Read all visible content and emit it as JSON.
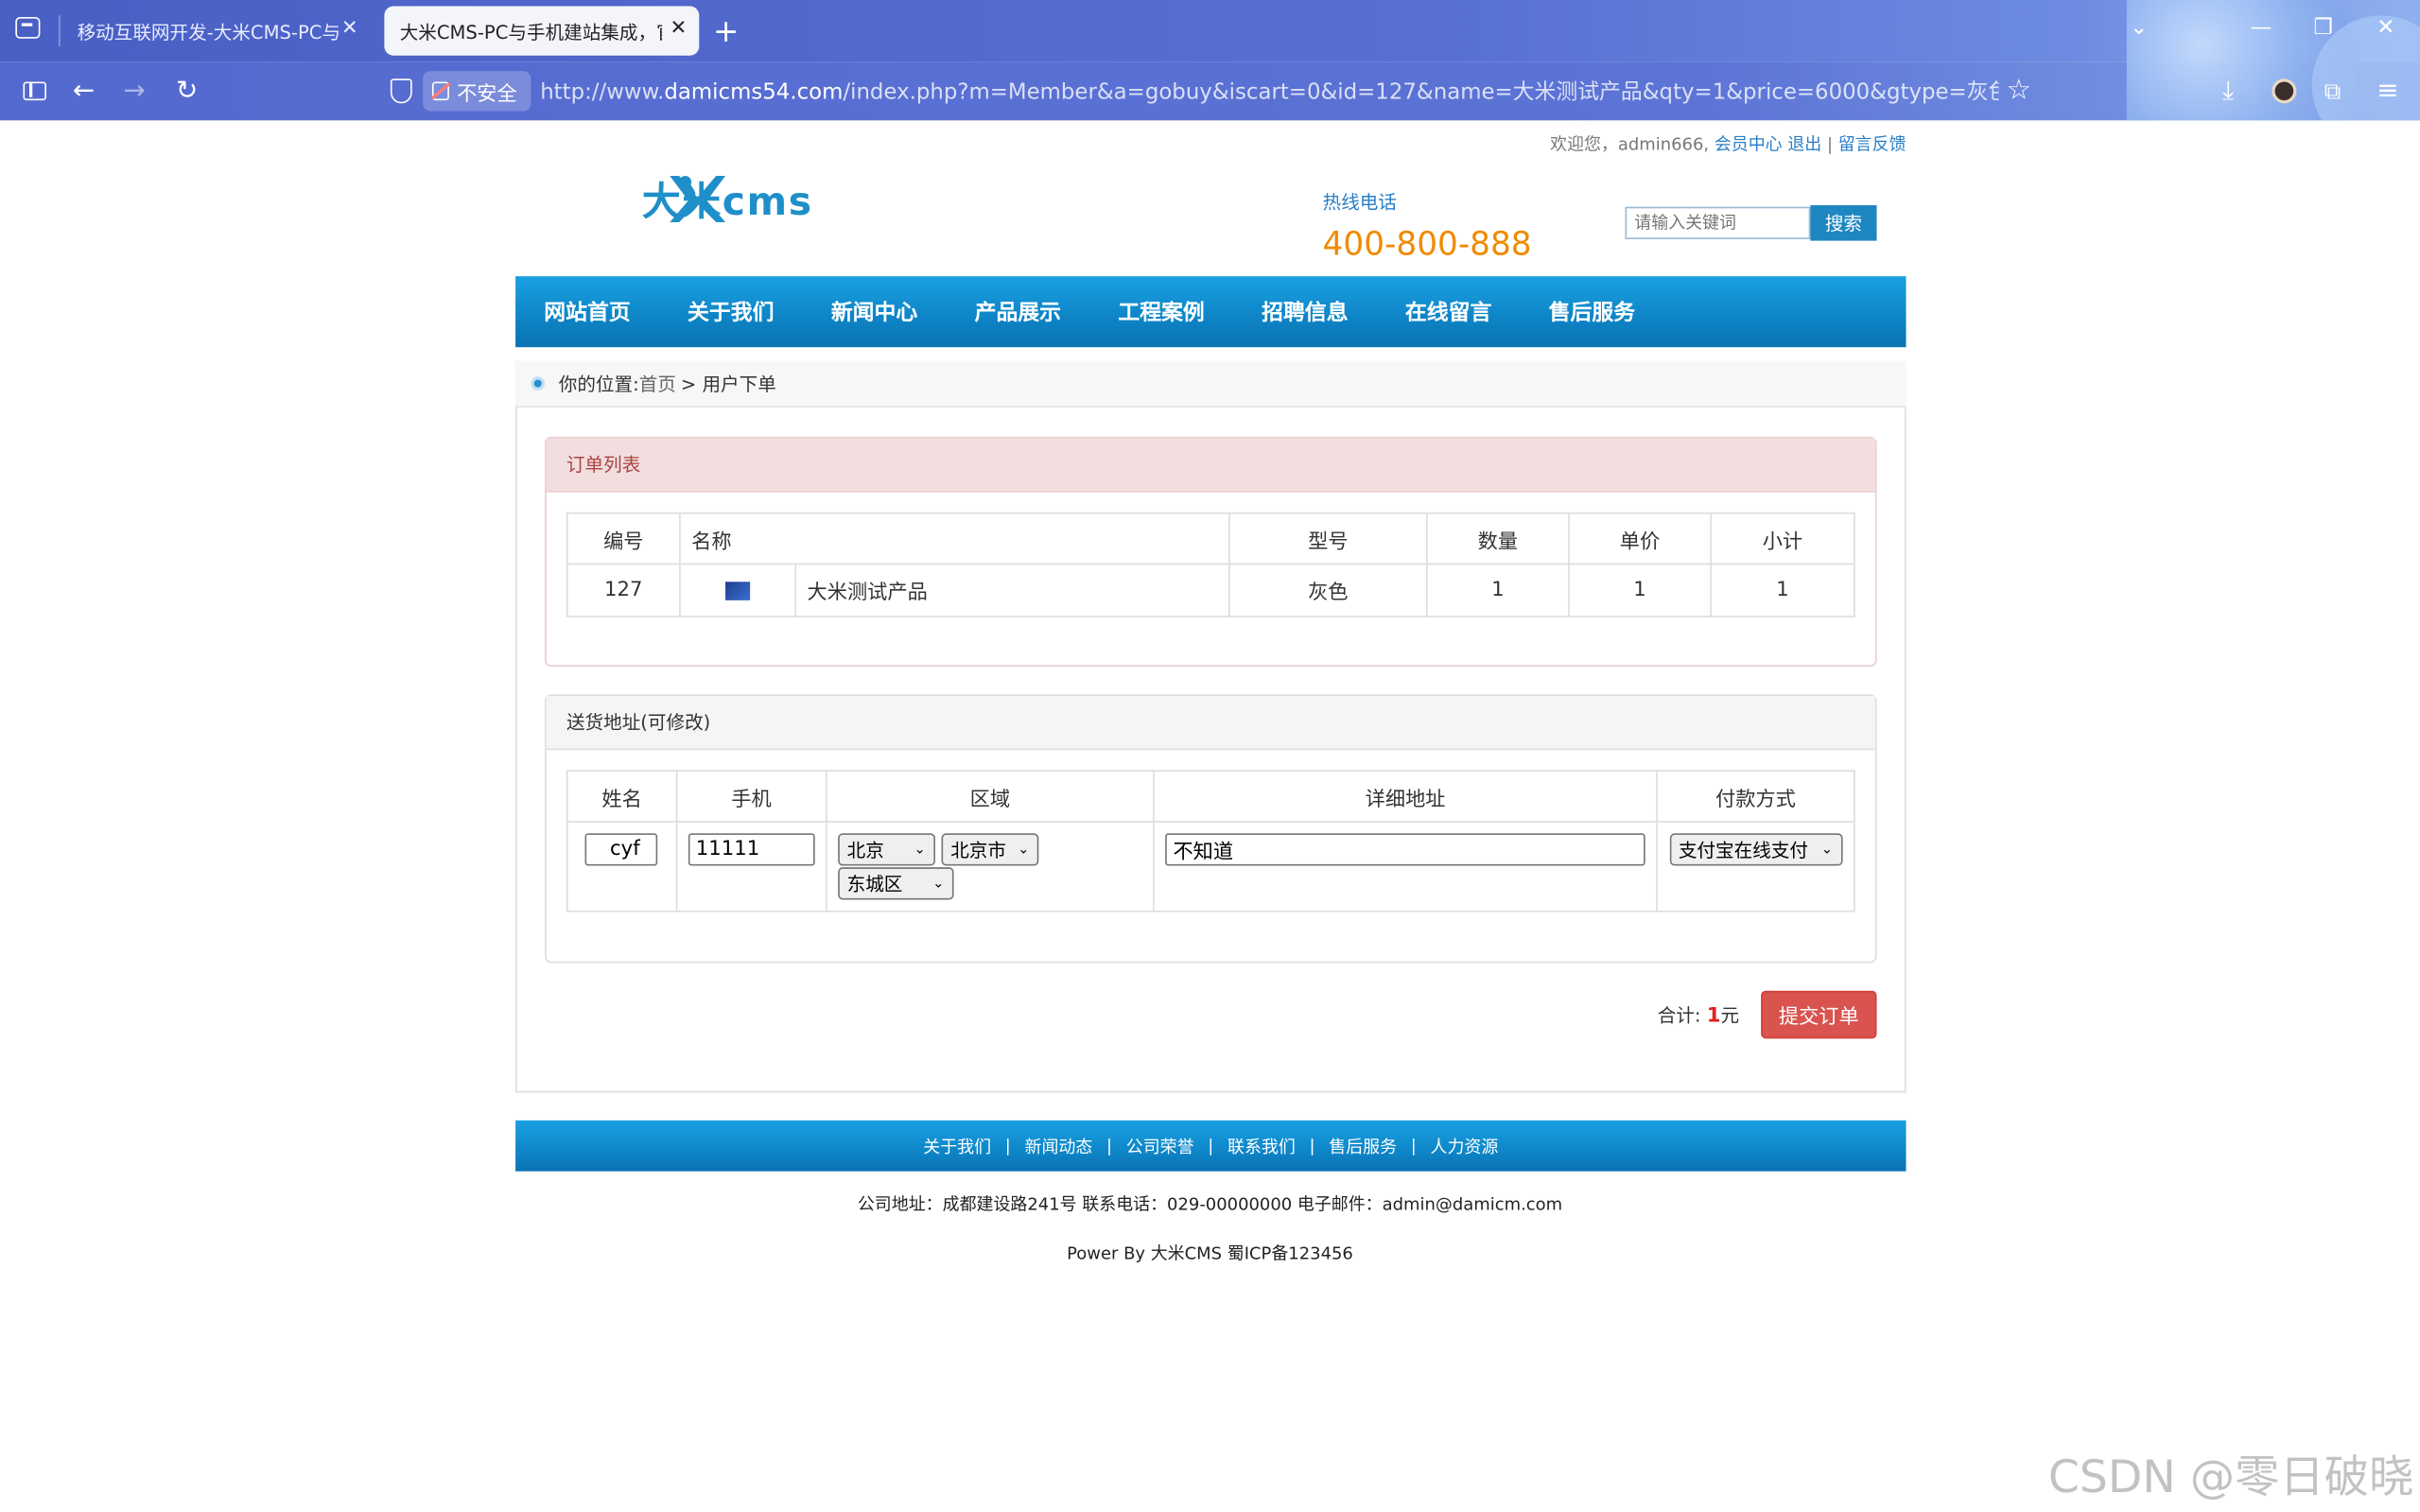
{
  "browser": {
    "tabs": [
      {
        "label": "移动互联网开发-大米CMS-PC与手机"
      },
      {
        "label": "大米CMS-PC与手机建站集成，官网"
      }
    ],
    "new_tab": "+",
    "security_label": "不安全",
    "url_prefix": "http://www.",
    "url_domain": "damicms54.com",
    "url_path": "/index.php?m=Member&a=gobuy&iscart=0&id=127&name=大米测试产品&qty=1&price=6000&gtype=灰色&pic=/Public/Uploads"
  },
  "header": {
    "welcome": "欢迎您，admin666,",
    "member_center": "会员中心",
    "logout": "退出",
    "feedback": "留言反馈",
    "logo_text": "大米cms",
    "hotline_label": "热线电话",
    "hotline_number": "400-800-888",
    "search_placeholder": "请输入关键词",
    "search_button": "搜索"
  },
  "nav": {
    "items": [
      "网站首页",
      "关于我们",
      "新闻中心",
      "产品展示",
      "工程案例",
      "招聘信息",
      "在线留言",
      "售后服务"
    ]
  },
  "breadcrumb": {
    "prefix": "你的位置:",
    "home": "首页",
    "current": "> 用户下单"
  },
  "order": {
    "title": "订单列表",
    "headers": [
      "编号",
      "名称",
      "型号",
      "数量",
      "单价",
      "小计"
    ],
    "rows": [
      {
        "id": "127",
        "name": "大米测试产品",
        "model": "灰色",
        "qty": "1",
        "price": "1",
        "subtotal": "1"
      }
    ]
  },
  "shipping": {
    "title": "送货地址(可修改)",
    "headers": [
      "姓名",
      "手机",
      "区域",
      "详细地址",
      "付款方式"
    ],
    "name": "cyf",
    "phone": "11111",
    "province": "北京",
    "city": "北京市",
    "district": "东城区",
    "address": "不知道",
    "payment": "支付宝在线支付"
  },
  "summary": {
    "label": "合计:",
    "amount": "1",
    "unit": "元",
    "submit": "提交订单"
  },
  "footer": {
    "links": [
      "关于我们",
      "新闻动态",
      "公司荣誉",
      "联系我们",
      "售后服务",
      "人力资源"
    ],
    "address": "公司地址：成都建设路241号 联系电话：029-00000000 电子邮件：admin@damicm.com",
    "power": "Power By 大米CMS  蜀ICP备123456"
  },
  "watermark": "CSDN @零日破晓"
}
